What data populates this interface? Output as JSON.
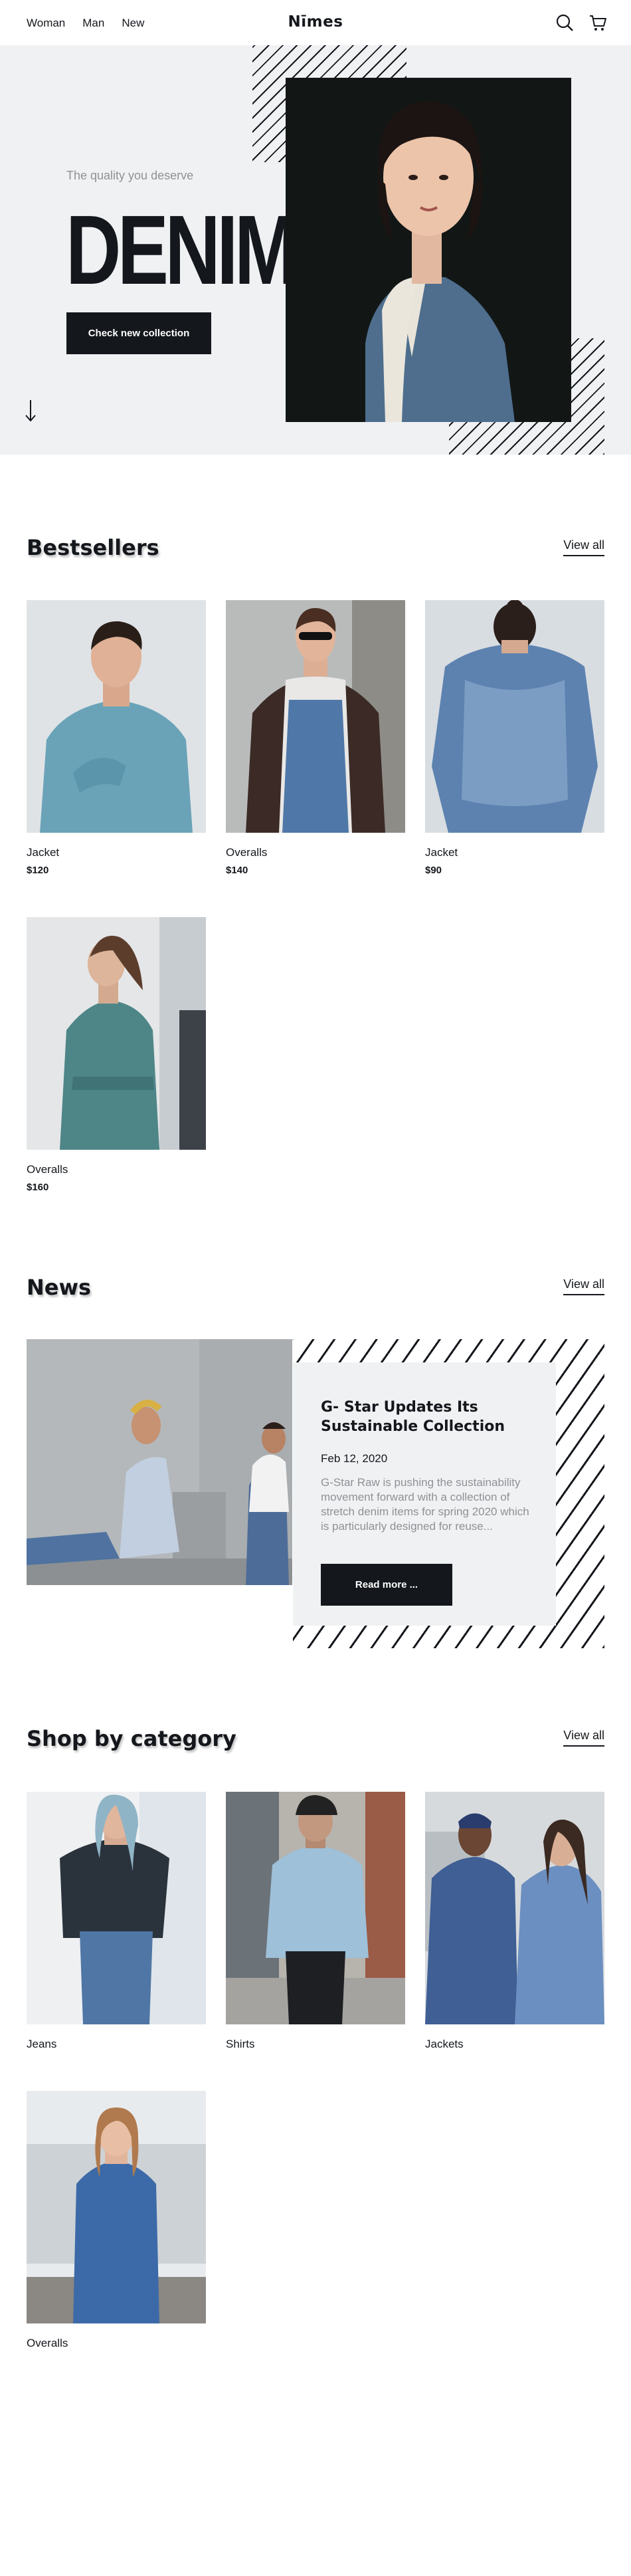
{
  "header": {
    "nav": [
      "Woman",
      "Man",
      "New"
    ],
    "logo": "Nīmes",
    "icons": [
      "search-icon",
      "cart-icon"
    ]
  },
  "hero": {
    "tagline": "The quality you deserve",
    "title": "DENIM",
    "button": "Check new collection",
    "scroll_icon": "arrow-down-icon"
  },
  "bestsellers": {
    "title": "Bestsellers",
    "view_all": "View all",
    "items": [
      {
        "name": "Jacket",
        "price": "$120"
      },
      {
        "name": "Overalls",
        "price": "$140"
      },
      {
        "name": "Jacket",
        "price": "$90"
      },
      {
        "name": "Overalls",
        "price": "$160"
      }
    ]
  },
  "news": {
    "title": "News",
    "view_all": "View all",
    "article": {
      "title": "G- Star Updates Its Sustainable Collection",
      "date": "Feb 12, 2020",
      "excerpt": "G-Star Raw is pushing the sustainability movement forward with a collection of stretch denim items for spring 2020 which is particularly designed for reuse...",
      "button": "Read more ..."
    }
  },
  "categories": {
    "title": "Shop by category",
    "view_all": "View all",
    "items": [
      "Jeans",
      "Shirts",
      "Jackets",
      "Overalls"
    ]
  },
  "colors": {
    "dark": "#14171c",
    "light_bg": "#f0f1f3",
    "muted_text": "#8f9196"
  }
}
